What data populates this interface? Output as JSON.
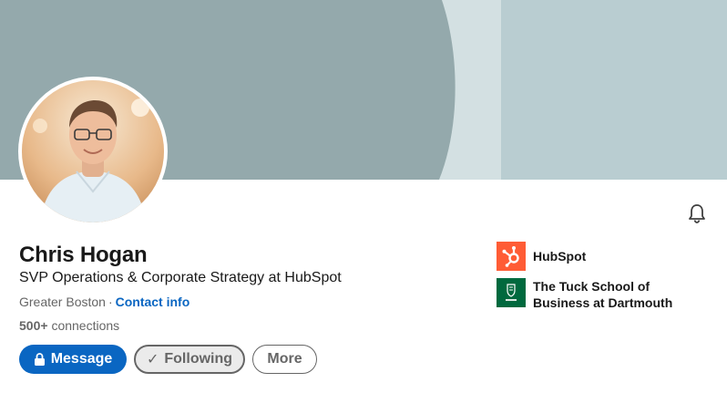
{
  "profile": {
    "name": "Chris Hogan",
    "headline": "SVP Operations & Corporate Strategy at HubSpot",
    "location": "Greater Boston",
    "separator": "·",
    "contact_info": "Contact info",
    "connections_count": "500+",
    "connections_label": "connections"
  },
  "actions": {
    "message_label": "Message",
    "following_label": "Following",
    "following_check": "✓",
    "more_label": "More"
  },
  "organizations": [
    {
      "name": "HubSpot",
      "logo": "hubspot-logo",
      "color": "#ff5c35"
    },
    {
      "name": "The Tuck School of Business at Dartmouth",
      "logo": "tuck-logo",
      "color": "#00693e"
    }
  ],
  "colors": {
    "primary_blue": "#0a66c2",
    "banner_gray": "#94a9ac",
    "banner_light": "#d3e0e2",
    "banner_blue_gray": "#b9cdd1"
  },
  "icons": {
    "notifications": "bell-icon",
    "message": "lock-icon"
  }
}
